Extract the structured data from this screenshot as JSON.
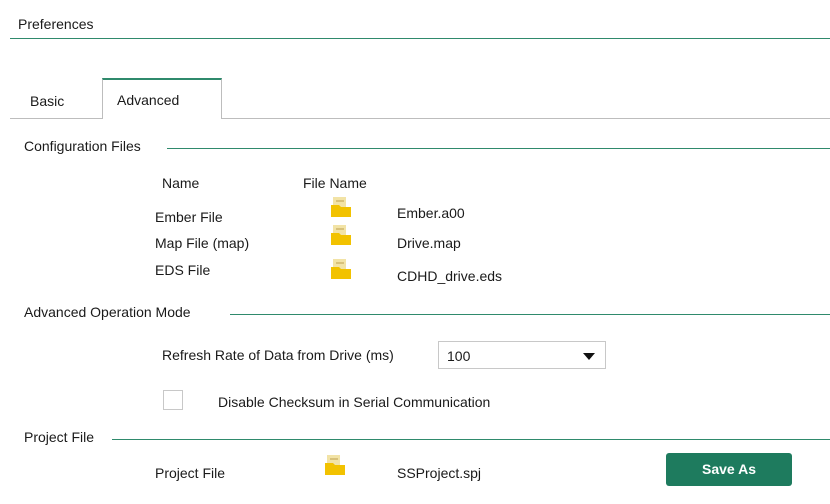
{
  "header": {
    "title": "Preferences"
  },
  "tabs": [
    {
      "label": "Basic"
    },
    {
      "label": "Advanced"
    }
  ],
  "config_files": {
    "heading": "Configuration Files",
    "col_name": "Name",
    "col_file_name": "File Name",
    "rows": [
      {
        "name": "Ember File",
        "file": "Ember.a00",
        "icon": "folder-icon"
      },
      {
        "name": "Map File (map)",
        "file": "Drive.map",
        "icon": "folder-icon"
      },
      {
        "name": "EDS File",
        "file": "CDHD_drive.eds",
        "icon": "folder-icon"
      }
    ]
  },
  "advanced_mode": {
    "heading": "Advanced Operation Mode",
    "refresh_label": "Refresh Rate of Data from Drive (ms)",
    "refresh_value": "100",
    "checksum_label": "Disable Checksum in Serial Communication",
    "checksum_checked": false
  },
  "project_file": {
    "heading": "Project File",
    "label": "Project File",
    "file": "SSProject.spj",
    "icon": "folder-icon",
    "save_as_label": "Save As"
  },
  "colors": {
    "accent": "#2f8a6c",
    "button": "#1e7b5e",
    "folder": "#f2c200"
  }
}
